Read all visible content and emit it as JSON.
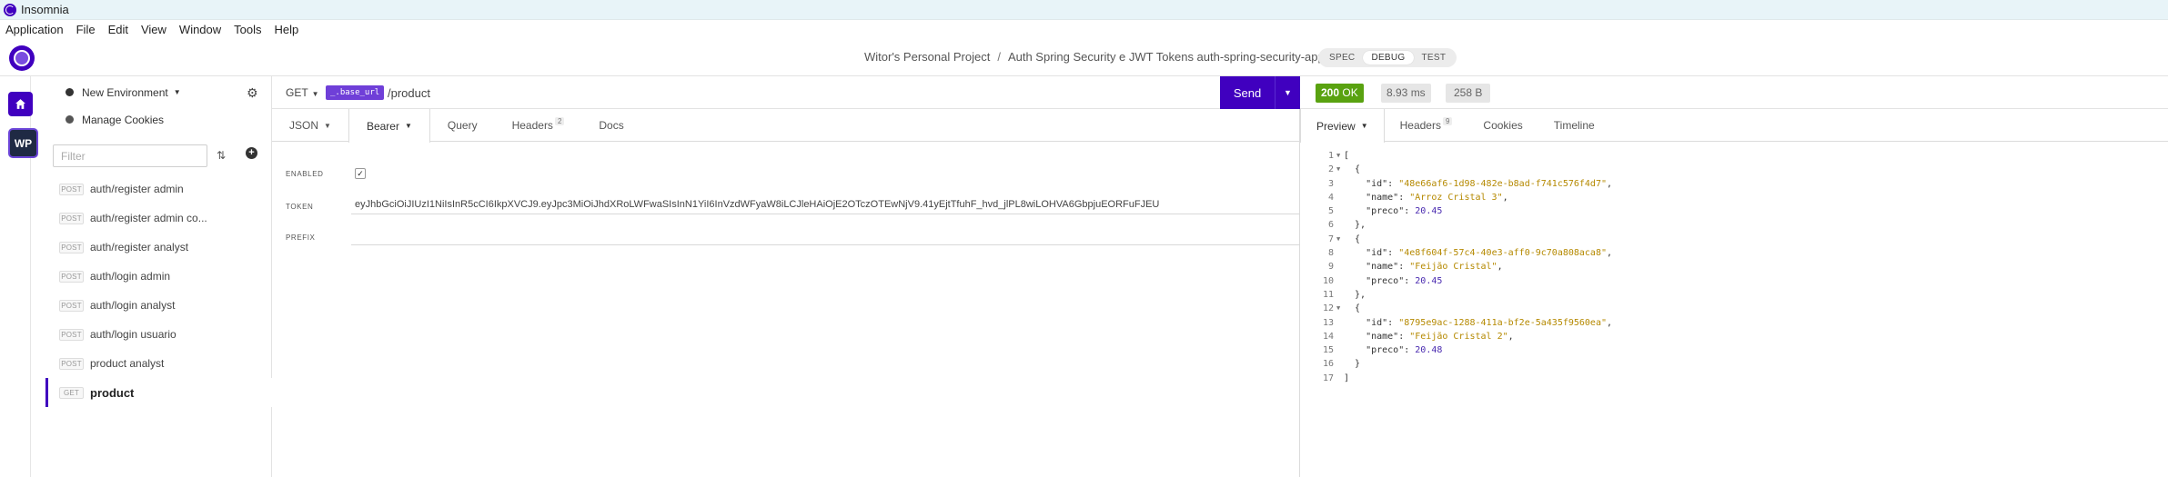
{
  "window": {
    "title": "Insomnia"
  },
  "menu": [
    "Application",
    "File",
    "Edit",
    "View",
    "Window",
    "Tools",
    "Help"
  ],
  "header": {
    "project": "Witor's Personal Project",
    "separator": "/",
    "workspace": "Auth Spring Security e JWT Tokens auth-spring-security-app",
    "modes": [
      "SPEC",
      "DEBUG",
      "TEST"
    ],
    "active_mode": "DEBUG"
  },
  "activity": {
    "home_icon": "home-icon",
    "workspace_initials": "WP"
  },
  "sidebar": {
    "environment": "New Environment",
    "cookies": "Manage Cookies",
    "filter_placeholder": "Filter",
    "requests": [
      {
        "method": "POST",
        "label": "auth/register admin"
      },
      {
        "method": "POST",
        "label": "auth/register admin co..."
      },
      {
        "method": "POST",
        "label": "auth/register analyst"
      },
      {
        "method": "POST",
        "label": "auth/login admin"
      },
      {
        "method": "POST",
        "label": "auth/login analyst"
      },
      {
        "method": "POST",
        "label": "auth/login usuario"
      },
      {
        "method": "POST",
        "label": "product analyst"
      },
      {
        "method": "GET",
        "label": "product"
      }
    ]
  },
  "request": {
    "method": "GET",
    "base_url_tag": "_.base_url",
    "path": "/product",
    "send_label": "Send",
    "tabs": {
      "body": "JSON",
      "auth": "Bearer",
      "query": "Query",
      "headers": "Headers",
      "headers_count": "2",
      "docs": "Docs"
    },
    "auth": {
      "enabled_label": "ENABLED",
      "token_label": "TOKEN",
      "token_value": "eyJhbGciOiJIUzI1NiIsInR5cCI6IkpXVCJ9.eyJpc3MiOiJhdXRoLWFwaSIsInN1YiI6InVzdWFyaW8iLCJleHAiOjE2OTczOTEwNjV9.41yEjtTfuhF_hvd_jlPL8wiLOHVA6GbpjuEORFuFJEU",
      "prefix_label": "PREFIX",
      "prefix_value": ""
    }
  },
  "response": {
    "status_code": "200",
    "status_text": "OK",
    "time": "8.93 ms",
    "size": "258 B",
    "tabs": {
      "preview": "Preview",
      "headers": "Headers",
      "headers_count": "9",
      "cookies": "Cookies",
      "timeline": "Timeline"
    },
    "lines": [
      {
        "n": "1",
        "fold": true,
        "parts": [
          [
            "k",
            "["
          ]
        ]
      },
      {
        "n": "2",
        "fold": true,
        "parts": [
          [
            "k",
            "  {"
          ]
        ]
      },
      {
        "n": "3",
        "fold": false,
        "parts": [
          [
            "k",
            "    \"id\": "
          ],
          [
            "s",
            "\"48e66af6-1d98-482e-b8ad-f741c576f4d7\""
          ],
          [
            "k",
            ","
          ]
        ]
      },
      {
        "n": "4",
        "fold": false,
        "parts": [
          [
            "k",
            "    \"name\": "
          ],
          [
            "s",
            "\"Arroz Cristal 3\""
          ],
          [
            "k",
            ","
          ]
        ]
      },
      {
        "n": "5",
        "fold": false,
        "parts": [
          [
            "k",
            "    \"preco\": "
          ],
          [
            "n",
            "20.45"
          ]
        ]
      },
      {
        "n": "6",
        "fold": false,
        "parts": [
          [
            "k",
            "  },"
          ]
        ]
      },
      {
        "n": "7",
        "fold": true,
        "parts": [
          [
            "k",
            "  {"
          ]
        ]
      },
      {
        "n": "8",
        "fold": false,
        "parts": [
          [
            "k",
            "    \"id\": "
          ],
          [
            "s",
            "\"4e8f604f-57c4-40e3-aff0-9c70a808aca8\""
          ],
          [
            "k",
            ","
          ]
        ]
      },
      {
        "n": "9",
        "fold": false,
        "parts": [
          [
            "k",
            "    \"name\": "
          ],
          [
            "s",
            "\"Feijão Cristal\""
          ],
          [
            "k",
            ","
          ]
        ]
      },
      {
        "n": "10",
        "fold": false,
        "parts": [
          [
            "k",
            "    \"preco\": "
          ],
          [
            "n",
            "20.45"
          ]
        ]
      },
      {
        "n": "11",
        "fold": false,
        "parts": [
          [
            "k",
            "  },"
          ]
        ]
      },
      {
        "n": "12",
        "fold": true,
        "parts": [
          [
            "k",
            "  {"
          ]
        ]
      },
      {
        "n": "13",
        "fold": false,
        "parts": [
          [
            "k",
            "    \"id\": "
          ],
          [
            "s",
            "\"8795e9ac-1288-411a-bf2e-5a435f9560ea\""
          ],
          [
            "k",
            ","
          ]
        ]
      },
      {
        "n": "14",
        "fold": false,
        "parts": [
          [
            "k",
            "    \"name\": "
          ],
          [
            "s",
            "\"Feijão Cristal 2\""
          ],
          [
            "k",
            ","
          ]
        ]
      },
      {
        "n": "15",
        "fold": false,
        "parts": [
          [
            "k",
            "    \"preco\": "
          ],
          [
            "n",
            "20.48"
          ]
        ]
      },
      {
        "n": "16",
        "fold": false,
        "parts": [
          [
            "k",
            "  }"
          ]
        ]
      },
      {
        "n": "17",
        "fold": false,
        "parts": [
          [
            "k",
            "]"
          ]
        ]
      }
    ]
  },
  "colors": {
    "accent": "#4000bf",
    "status_ok": "#59a210",
    "json_string": "#b58900",
    "json_number": "#4a2bb0"
  }
}
